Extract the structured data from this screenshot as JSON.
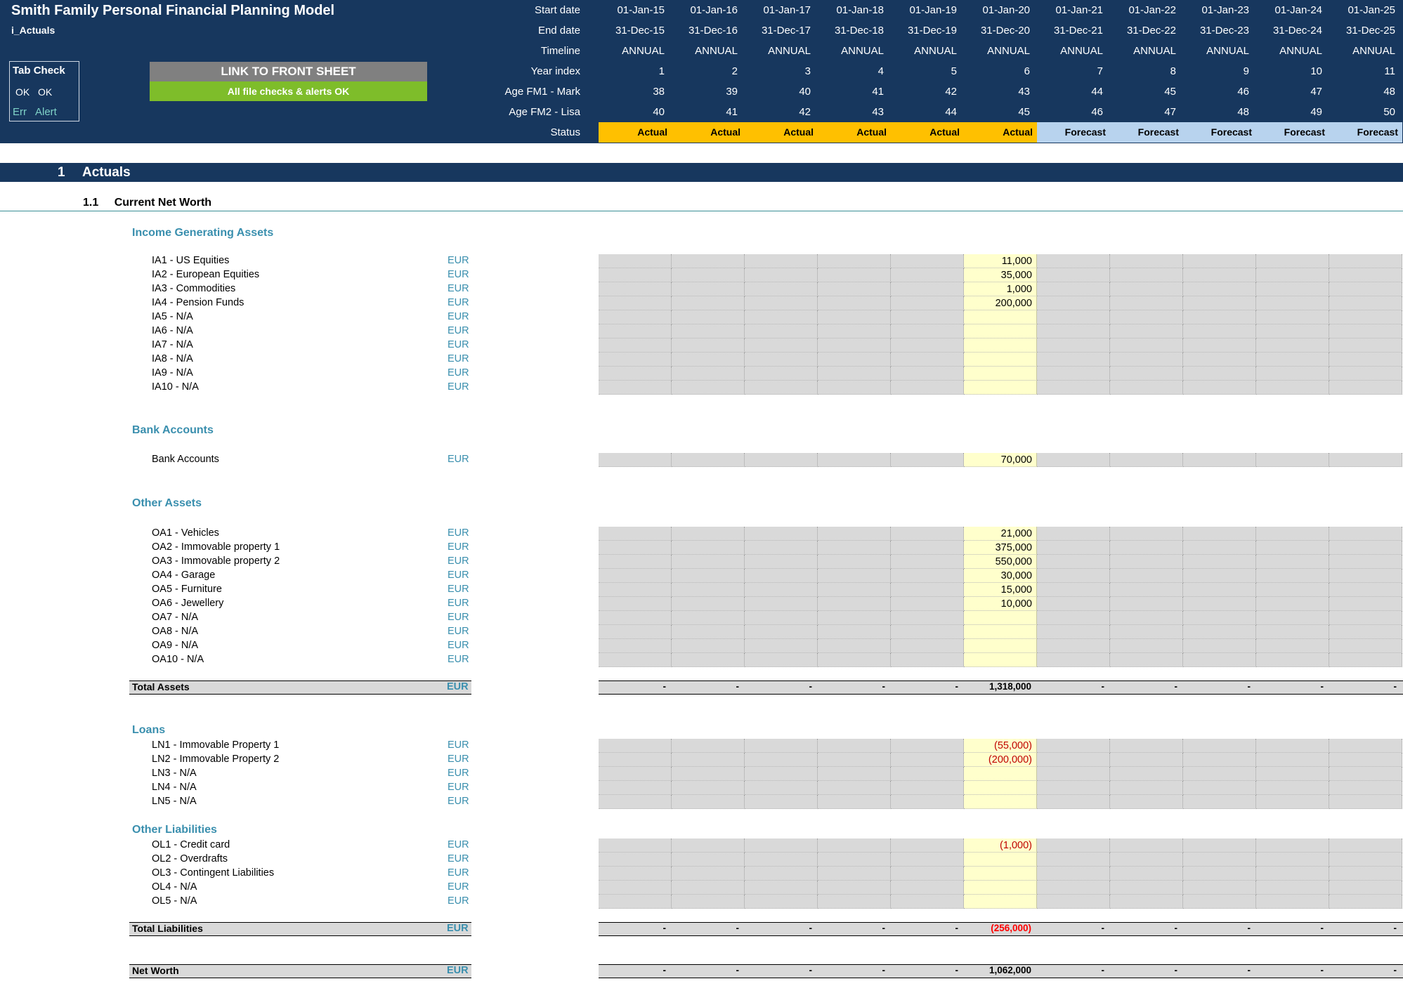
{
  "header": {
    "title": "Smith Family Personal Financial Planning Model",
    "sheet": "i_Actuals",
    "tab_check": {
      "title": "Tab Check",
      "ok1": "OK",
      "ok2": "OK",
      "err": "Err",
      "alert": "Alert"
    },
    "link_button": "LINK TO FRONT SHEET",
    "checks_status": "All file checks & alerts OK",
    "row_labels": [
      "Start date",
      "End date",
      "Timeline",
      "Year index",
      "Age FM1 - Mark",
      "Age FM2 - Lisa",
      "Status"
    ],
    "years": [
      {
        "start": "01-Jan-15",
        "end": "31-Dec-15",
        "timeline": "ANNUAL",
        "index": "1",
        "age1": "38",
        "age2": "40",
        "status": "Actual"
      },
      {
        "start": "01-Jan-16",
        "end": "31-Dec-16",
        "timeline": "ANNUAL",
        "index": "2",
        "age1": "39",
        "age2": "41",
        "status": "Actual"
      },
      {
        "start": "01-Jan-17",
        "end": "31-Dec-17",
        "timeline": "ANNUAL",
        "index": "3",
        "age1": "40",
        "age2": "42",
        "status": "Actual"
      },
      {
        "start": "01-Jan-18",
        "end": "31-Dec-18",
        "timeline": "ANNUAL",
        "index": "4",
        "age1": "41",
        "age2": "43",
        "status": "Actual"
      },
      {
        "start": "01-Jan-19",
        "end": "31-Dec-19",
        "timeline": "ANNUAL",
        "index": "5",
        "age1": "42",
        "age2": "44",
        "status": "Actual"
      },
      {
        "start": "01-Jan-20",
        "end": "31-Dec-20",
        "timeline": "ANNUAL",
        "index": "6",
        "age1": "43",
        "age2": "45",
        "status": "Actual"
      },
      {
        "start": "01-Jan-21",
        "end": "31-Dec-21",
        "timeline": "ANNUAL",
        "index": "7",
        "age1": "44",
        "age2": "46",
        "status": "Forecast"
      },
      {
        "start": "01-Jan-22",
        "end": "31-Dec-22",
        "timeline": "ANNUAL",
        "index": "8",
        "age1": "45",
        "age2": "47",
        "status": "Forecast"
      },
      {
        "start": "01-Jan-23",
        "end": "31-Dec-23",
        "timeline": "ANNUAL",
        "index": "9",
        "age1": "46",
        "age2": "48",
        "status": "Forecast"
      },
      {
        "start": "01-Jan-24",
        "end": "31-Dec-24",
        "timeline": "ANNUAL",
        "index": "10",
        "age1": "47",
        "age2": "49",
        "status": "Forecast"
      },
      {
        "start": "01-Jan-25",
        "end": "31-Dec-25",
        "timeline": "ANNUAL",
        "index": "11",
        "age1": "48",
        "age2": "50",
        "status": "Forecast"
      }
    ]
  },
  "section": {
    "number": "1",
    "title": "Actuals"
  },
  "subsection": {
    "number": "1.1",
    "title": "Current Net Worth"
  },
  "groups": [
    {
      "title": "Income Generating Assets",
      "unit": "EUR",
      "rows": [
        {
          "label": "IA1 - US Equities",
          "value": "11,000"
        },
        {
          "label": "IA2 - European Equities",
          "value": "35,000"
        },
        {
          "label": "IA3 - Commodities",
          "value": "1,000"
        },
        {
          "label": "IA4 - Pension Funds",
          "value": "200,000"
        },
        {
          "label": "IA5 - N/A",
          "value": ""
        },
        {
          "label": "IA6 - N/A",
          "value": ""
        },
        {
          "label": "IA7 - N/A",
          "value": ""
        },
        {
          "label": "IA8 - N/A",
          "value": ""
        },
        {
          "label": "IA9 - N/A",
          "value": ""
        },
        {
          "label": "IA10 - N/A",
          "value": ""
        }
      ]
    },
    {
      "title": "Bank Accounts",
      "unit": "EUR",
      "rows": [
        {
          "label": "Bank Accounts",
          "value": "70,000"
        }
      ]
    },
    {
      "title": "Other Assets",
      "unit": "EUR",
      "rows": [
        {
          "label": "OA1 - Vehicles",
          "value": "21,000"
        },
        {
          "label": "OA2 - Immovable property 1",
          "value": "375,000"
        },
        {
          "label": "OA3 - Immovable property 2",
          "value": "550,000"
        },
        {
          "label": "OA4 - Garage",
          "value": "30,000"
        },
        {
          "label": "OA5 - Furniture",
          "value": "15,000"
        },
        {
          "label": "OA6 - Jewellery",
          "value": "10,000"
        },
        {
          "label": "OA7 - N/A",
          "value": ""
        },
        {
          "label": "OA8 - N/A",
          "value": ""
        },
        {
          "label": "OA9 - N/A",
          "value": ""
        },
        {
          "label": "OA10 - N/A",
          "value": ""
        }
      ]
    },
    {
      "title": "Loans",
      "unit": "EUR",
      "rows": [
        {
          "label": "LN1 - Immovable Property 1",
          "value": "(55,000)"
        },
        {
          "label": "LN2 - Immovable Property 2",
          "value": "(200,000)"
        },
        {
          "label": "LN3 - N/A",
          "value": ""
        },
        {
          "label": "LN4 - N/A",
          "value": ""
        },
        {
          "label": "LN5 - N/A",
          "value": ""
        }
      ]
    },
    {
      "title": "Other Liabilities",
      "unit": "EUR",
      "rows": [
        {
          "label": "OL1 - Credit card",
          "value": "(1,000)"
        },
        {
          "label": "OL2 - Overdrafts",
          "value": ""
        },
        {
          "label": "OL3 - Contingent Liabilities",
          "value": ""
        },
        {
          "label": "OL4 - N/A",
          "value": ""
        },
        {
          "label": "OL5 - N/A",
          "value": ""
        }
      ]
    }
  ],
  "totals": [
    {
      "label": "Total Assets",
      "unit": "EUR",
      "values": [
        "-",
        "-",
        "-",
        "-",
        "-",
        "1,318,000",
        "-",
        "-",
        "-",
        "-",
        "-"
      ]
    },
    {
      "label": "Total Liabilities",
      "unit": "EUR",
      "values": [
        "-",
        "-",
        "-",
        "-",
        "-",
        "(256,000)",
        "-",
        "-",
        "-",
        "-",
        "-"
      ]
    },
    {
      "label": "Net Worth",
      "unit": "EUR",
      "values": [
        "-",
        "-",
        "-",
        "-",
        "-",
        "1,062,000",
        "-",
        "-",
        "-",
        "-",
        "-"
      ]
    }
  ]
}
